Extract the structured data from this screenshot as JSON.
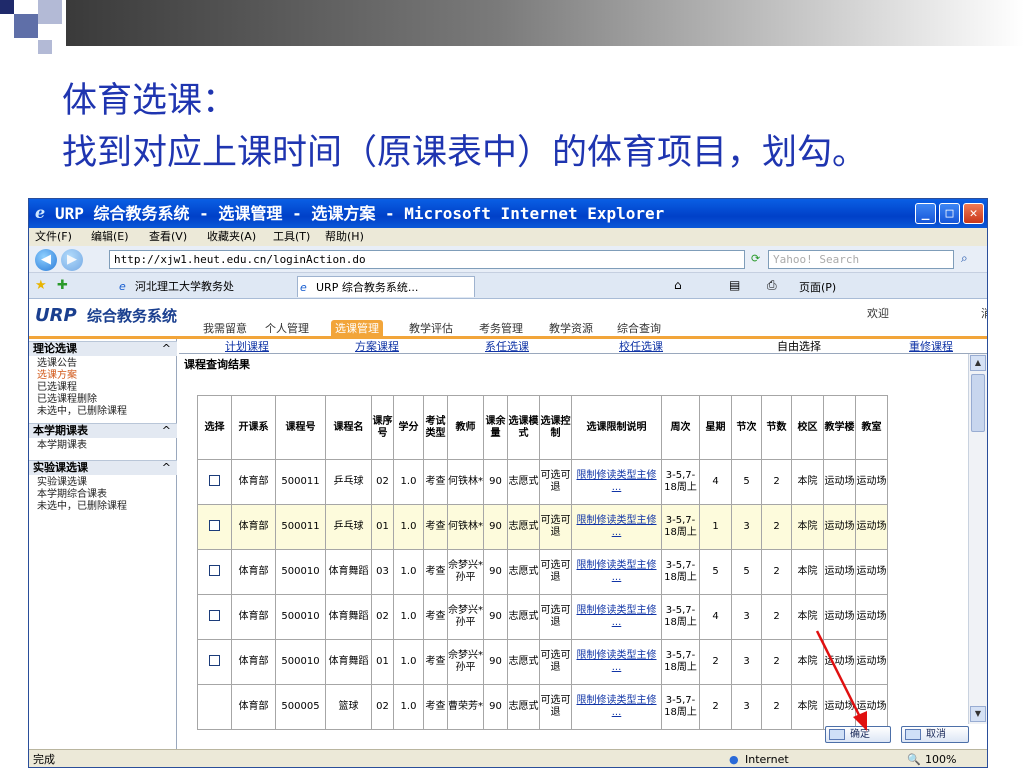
{
  "slide": {
    "title_line1": "体育选课：",
    "title_line2": "找到对应上课时间（原课表中）的体育项目，划勾。"
  },
  "browser": {
    "title": "URP 综合教务系统 - 选课管理 - 选课方案 - Microsoft Internet Explorer",
    "menu": [
      "文件(F)",
      "编辑(E)",
      "查看(V)",
      "收藏夹(A)",
      "工具(T)",
      "帮助(H)"
    ],
    "address": "http://xjw1.heut.edu.cn/loginAction.do",
    "search_placeholder": "Yahoo! Search",
    "tabs": [
      "河北理工大学教务处",
      "URP 综合教务系统..."
    ],
    "page_menu": "页面(P)",
    "status_left": "完成",
    "status_zone": "Internet",
    "zoom": "100%"
  },
  "app": {
    "logo_en": "URP",
    "logo_cn": "综合教务系统",
    "nav": [
      "我需留意",
      "个人管理",
      "选课管理",
      "教学评估",
      "考务管理",
      "教学资源",
      "综合查询"
    ],
    "welcome": "欢迎",
    "welcome_tail": "消"
  },
  "sidebar": {
    "sections": [
      {
        "title": "理论选课",
        "items": [
          "选课公告",
          "选课方案",
          "已选课程",
          "已选课程删除",
          "未选中，已删除课程"
        ]
      },
      {
        "title": "本学期课表",
        "items": [
          "本学期课表"
        ]
      },
      {
        "title": "实验课选课",
        "items": [
          "实验课选课",
          "本学期综合课表",
          "未选中，已删除课程"
        ]
      }
    ]
  },
  "subnav": [
    "计划课程",
    "方案课程",
    "系任选课",
    "校任选课",
    "自由选择",
    "重修课程"
  ],
  "result_title": "课程查询结果",
  "table": {
    "headers": [
      "选择",
      "开课系",
      "课程号",
      "课程名",
      "课序号",
      "学分",
      "考试类型",
      "教师",
      "课余量",
      "选课模式",
      "选课控制",
      "选课限制说明",
      "周次",
      "星期",
      "节次",
      "节数",
      "校区",
      "教学楼",
      "教室"
    ],
    "rows": [
      [
        "",
        "体育部",
        "500011",
        "乒乓球",
        "02",
        "1.0",
        "考查",
        "何铁林*",
        "90",
        "志愿式",
        "可选可退",
        "限制修读类型主修 ...",
        "3-5,7-18周上",
        "4",
        "5",
        "2",
        "本院",
        "运动场",
        "运动场"
      ],
      [
        "",
        "体育部",
        "500011",
        "乒乓球",
        "01",
        "1.0",
        "考查",
        "何铁林*",
        "90",
        "志愿式",
        "可选可退",
        "限制修读类型主修 ...",
        "3-5,7-18周上",
        "1",
        "3",
        "2",
        "本院",
        "运动场",
        "运动场"
      ],
      [
        "",
        "体育部",
        "500010",
        "体育舞蹈",
        "03",
        "1.0",
        "考查",
        "佘梦兴*孙平",
        "90",
        "志愿式",
        "可选可退",
        "限制修读类型主修 ...",
        "3-5,7-18周上",
        "5",
        "5",
        "2",
        "本院",
        "运动场",
        "运动场"
      ],
      [
        "",
        "体育部",
        "500010",
        "体育舞蹈",
        "02",
        "1.0",
        "考查",
        "佘梦兴*孙平",
        "90",
        "志愿式",
        "可选可退",
        "限制修读类型主修 ...",
        "3-5,7-18周上",
        "4",
        "3",
        "2",
        "本院",
        "运动场",
        "运动场"
      ],
      [
        "",
        "体育部",
        "500010",
        "体育舞蹈",
        "01",
        "1.0",
        "考查",
        "佘梦兴*孙平",
        "90",
        "志愿式",
        "可选可退",
        "限制修读类型主修 ...",
        "3-5,7-18周上",
        "2",
        "3",
        "2",
        "本院",
        "运动场",
        "运动场"
      ],
      [
        "",
        "体育部",
        "500005",
        "篮球",
        "02",
        "1.0",
        "考查",
        "曹荣芳*",
        "90",
        "志愿式",
        "可选可退",
        "限制修读类型主修 ...",
        "3-5,7-18周上",
        "2",
        "3",
        "2",
        "本院",
        "运动场",
        "运动场"
      ]
    ]
  },
  "buttons": {
    "confirm": "确定",
    "cancel": "取消"
  },
  "colors": {
    "slide_title": "#1f35b0",
    "accent": "#f2a53a",
    "arrow": "#e01010"
  }
}
